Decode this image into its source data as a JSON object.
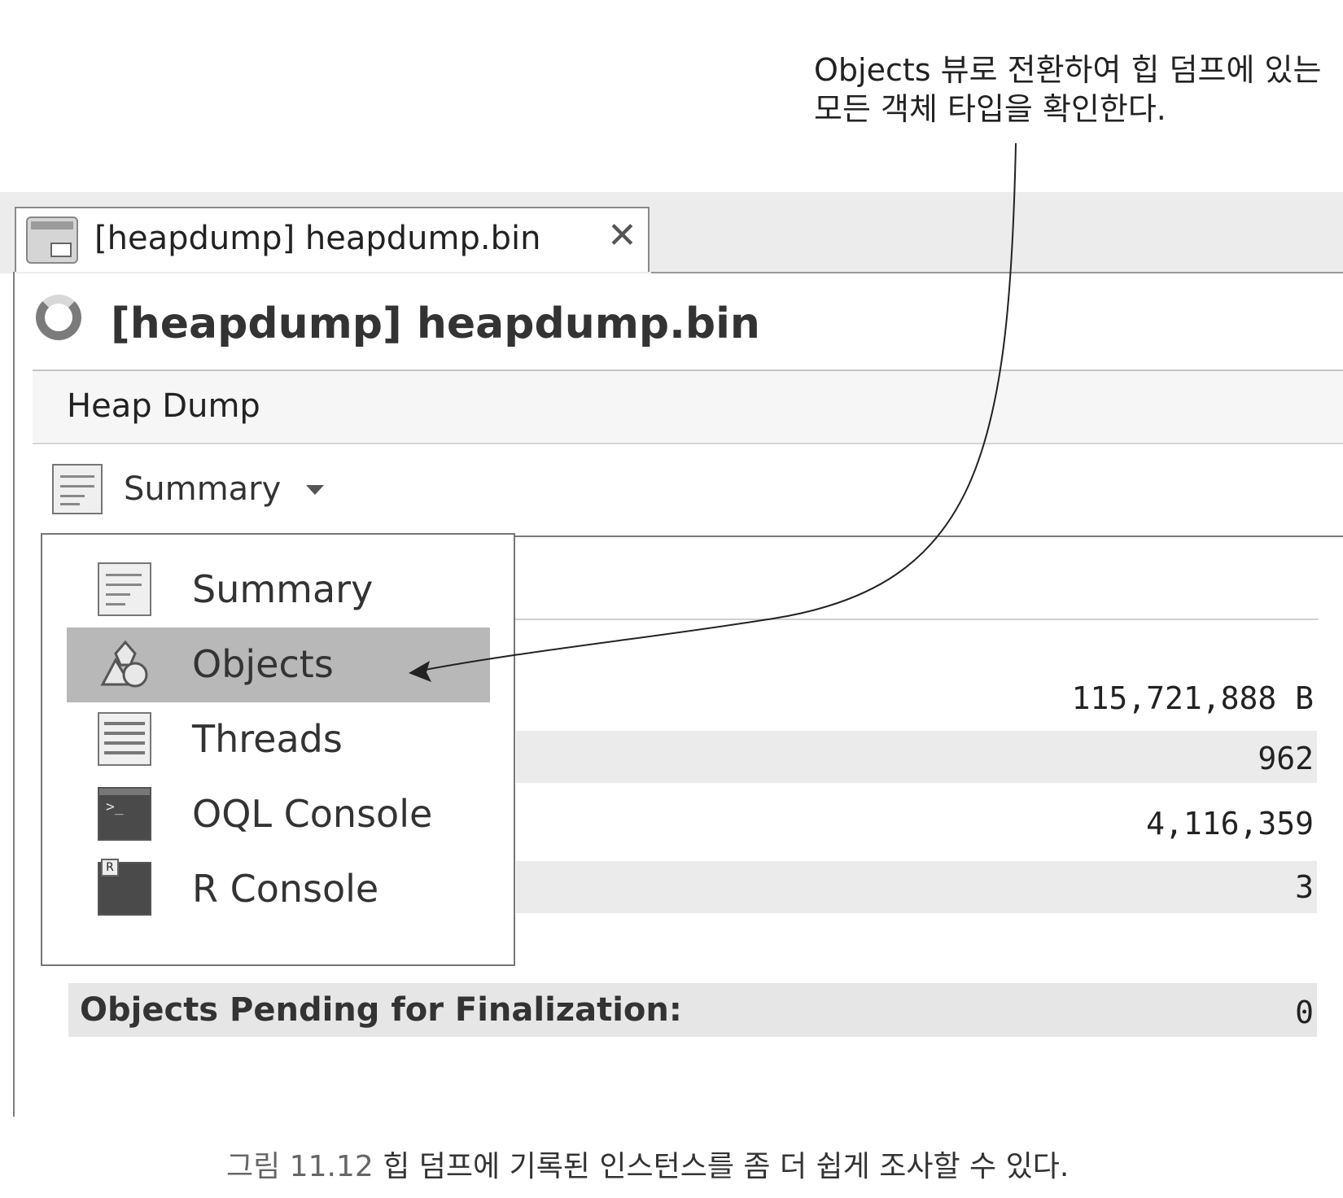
{
  "annotation": {
    "line1": "Objects 뷰로 전환하여 힙 덤프에 있는",
    "line2": "모든 객체 타입을 확인한다."
  },
  "tab": {
    "icon": "heapdump-icon",
    "title": "[heapdump] heapdump.bin",
    "close": "✕"
  },
  "header": {
    "icon": "loading-spinner-icon",
    "title": "[heapdump] heapdump.bin"
  },
  "section": {
    "label": "Heap Dump"
  },
  "view_selector": {
    "icon": "summary-icon",
    "label": "Summary"
  },
  "menu": {
    "items": [
      {
        "label": "Summary",
        "icon": "summary-icon",
        "selected": false
      },
      {
        "label": "Objects",
        "icon": "objects-icon",
        "selected": true
      },
      {
        "label": "Threads",
        "icon": "threads-icon",
        "selected": false
      },
      {
        "label": "OQL Console",
        "icon": "console-icon",
        "selected": false
      },
      {
        "label": "R Console",
        "icon": "r-console-icon",
        "selected": false
      }
    ]
  },
  "values": {
    "total_bytes": "115,721,888 B",
    "classes": "962",
    "instances": "4,116,359",
    "classloaders": "3"
  },
  "pending": {
    "label": "Objects Pending for Finalization:",
    "value": "0"
  },
  "caption": {
    "figure": "그림 11.12",
    "text": "힙 덤프에 기록된 인스턴스를 좀 더 쉽게 조사할 수 있다."
  },
  "colors": {
    "selected_bg": "#b8b8b8",
    "row_bg": "#ebebeb"
  }
}
